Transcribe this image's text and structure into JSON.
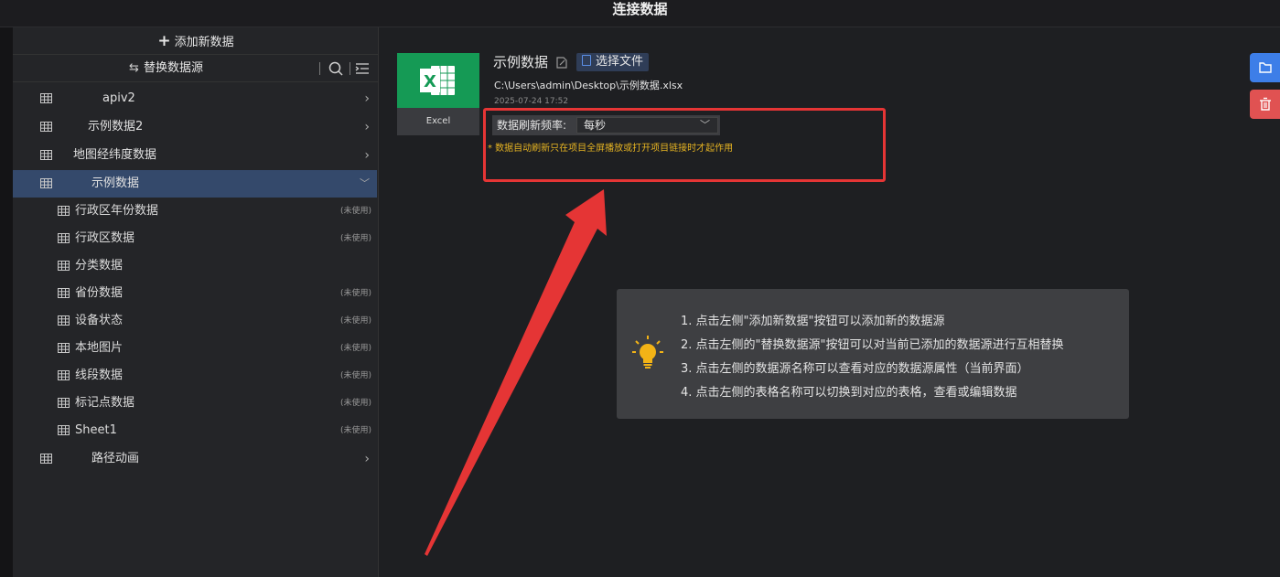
{
  "window": {
    "title": "连接数据"
  },
  "sidebar": {
    "add_label": "添加新数据",
    "replace_label": "替换数据源",
    "tools": [
      "search-icon",
      "collapse-list-icon"
    ],
    "sources": [
      {
        "label": "apiv2",
        "expanded": false
      },
      {
        "label": "示例数据2",
        "expanded": false
      },
      {
        "label": "地图经纬度数据",
        "expanded": false
      },
      {
        "label": "示例数据",
        "expanded": true
      },
      {
        "label": "路径动画",
        "expanded": false
      }
    ],
    "tables": [
      {
        "label": "行政区年份数据",
        "status": "(未使用)"
      },
      {
        "label": "行政区数据",
        "status": "(未使用)"
      },
      {
        "label": "分类数据",
        "status": ""
      },
      {
        "label": "省份数据",
        "status": "(未使用)"
      },
      {
        "label": "设备状态",
        "status": "(未使用)"
      },
      {
        "label": "本地图片",
        "status": "(未使用)"
      },
      {
        "label": "线段数据",
        "status": "(未使用)"
      },
      {
        "label": "标记点数据",
        "status": "(未使用)"
      },
      {
        "label": "Sheet1",
        "status": "(未使用)"
      }
    ]
  },
  "detail": {
    "source_type": "Excel",
    "name": "示例数据",
    "choose_file_label": "选择文件",
    "file_path": "C:\\Users\\admin\\Desktop\\示例数据.xlsx",
    "timestamp": "2025-07-24 17:52",
    "refresh_label": "数据刷新频率:",
    "refresh_value": "每秒",
    "refresh_note": "* 数据自动刷新只在项目全屏播放或打开项目链接时才起作用"
  },
  "tips": [
    "1. 点击左侧\"添加新数据\"按钮可以添加新的数据源",
    "2. 点击左侧的\"替换数据源\"按钮可以对当前已添加的数据源进行互相替换",
    "3. 点击左侧的数据源名称可以查看对应的数据源属性（当前界面）",
    "4. 点击左侧的表格名称可以切换到对应的表格，查看或编辑数据"
  ],
  "colors": {
    "accent": "#3d7ee8",
    "danger": "#e05252",
    "excel": "#159a55",
    "active_row": "#34496b",
    "note": "#e6b422",
    "annotation": "#e53535"
  }
}
